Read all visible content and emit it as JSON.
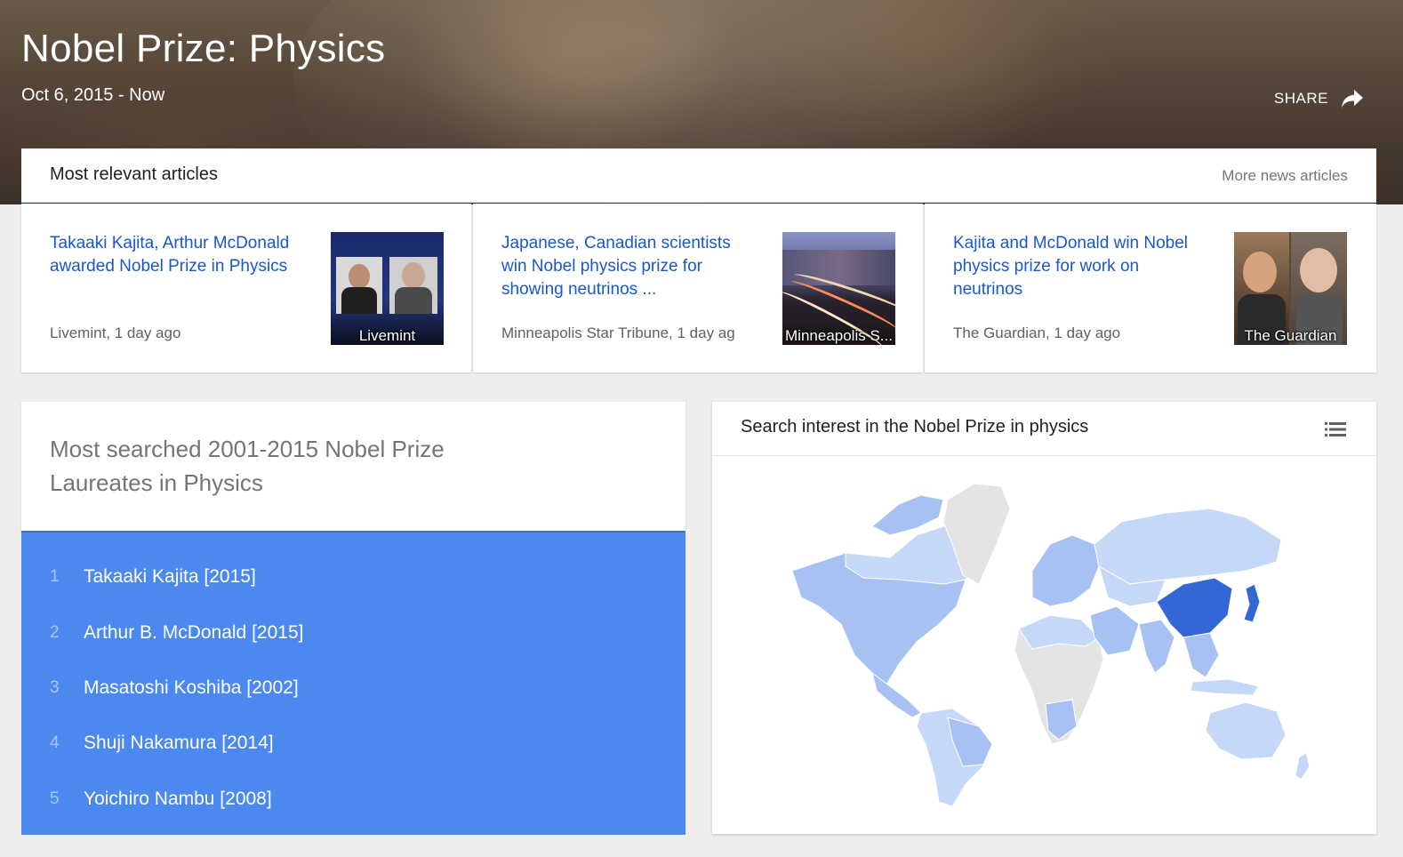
{
  "hero": {
    "title": "Nobel Prize: Physics",
    "date_range": "Oct 6, 2015 - Now",
    "share_label": "SHARE",
    "share_icon": "share-arrow-icon"
  },
  "articles": {
    "header": "Most relevant articles",
    "more_link": "More news articles",
    "items": [
      {
        "title": "Takaaki Kajita, Arthur McDonald awarded Nobel Prize in Physics",
        "source": "Livemint, 1 day ago",
        "thumb_caption": "Livemint"
      },
      {
        "title": "Japanese, Canadian scientists win Nobel physics prize for showing neutrinos ...",
        "source": "Minneapolis Star Tribune, 1 day ag",
        "thumb_caption": "Minneapolis S..."
      },
      {
        "title": "Kajita and McDonald win Nobel physics prize for work on neutrinos",
        "source": "The Guardian, 1 day ago",
        "thumb_caption": "The Guardian"
      }
    ]
  },
  "laureates": {
    "title": "Most searched 2001-2015 Nobel Prize Laureates in Physics",
    "items": [
      {
        "rank": "1",
        "name": "Takaaki Kajita [2015]"
      },
      {
        "rank": "2",
        "name": "Arthur B. McDonald [2015]"
      },
      {
        "rank": "3",
        "name": "Masatoshi Koshiba [2002]"
      },
      {
        "rank": "4",
        "name": "Shuji Nakamura [2014]"
      },
      {
        "rank": "5",
        "name": "Yoichiro Nambu [2008]"
      }
    ]
  },
  "map": {
    "title": "Search interest in the Nobel Prize in physics",
    "menu_icon": "list-icon",
    "colors": {
      "high": "#3367d6",
      "medium": "#a7c2f2",
      "low": "#c6d8f7",
      "none": "#e4e4e4"
    }
  }
}
